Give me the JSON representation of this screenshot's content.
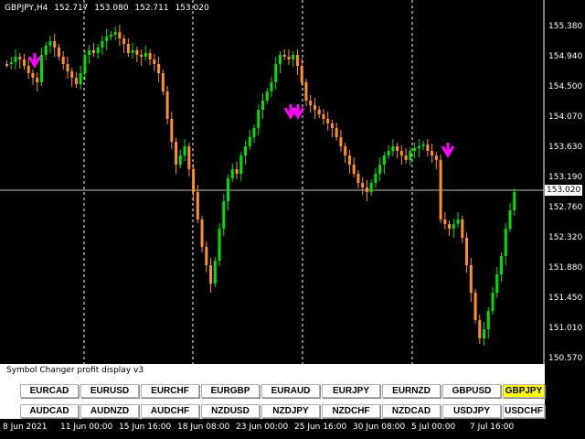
{
  "chart": {
    "symbol": "GBPJPY,H4",
    "ohlc": {
      "open": "152.717",
      "high": "153.080",
      "low": "152.711",
      "close": "153.020"
    },
    "current_price": "153.020",
    "colors": {
      "bull": "#00e000",
      "bear": "#ff9020",
      "arrow": "#ff00ff",
      "grid": "#ffffff",
      "current_line": "#c0c0c0"
    }
  },
  "price_axis": [
    "155.380",
    "154.940",
    "154.500",
    "154.070",
    "153.630",
    "153.190",
    "152.760",
    "152.320",
    "151.880",
    "151.450",
    "151.010",
    "150.570"
  ],
  "time_axis": [
    "8 Jun 2021",
    "11 Jun 00:00",
    "15 Jun 16:00",
    "18 Jun 08:00",
    "23 Jun 00:00",
    "25 Jun 16:00",
    "30 Jun 08:00",
    "5 Jul 00:00",
    "7 Jul 16:00"
  ],
  "panel": {
    "title": "Symbol Changer profit display v3",
    "row1": [
      "EURCAD",
      "EURUSD",
      "EURCHF",
      "EURGBP",
      "EURAUD",
      "EURJPY",
      "EURNZD",
      "GBPUSD",
      "GBPJPY"
    ],
    "row2": [
      "AUDCAD",
      "AUDNZD",
      "AUDCHF",
      "NZDUSD",
      "NZDJPY",
      "NZDCHF",
      "NZDCAD",
      "USDJPY",
      "USDCHF"
    ],
    "active": "GBPJPY"
  },
  "icons": {
    "signal_arrow": "arrow-down-icon"
  }
}
